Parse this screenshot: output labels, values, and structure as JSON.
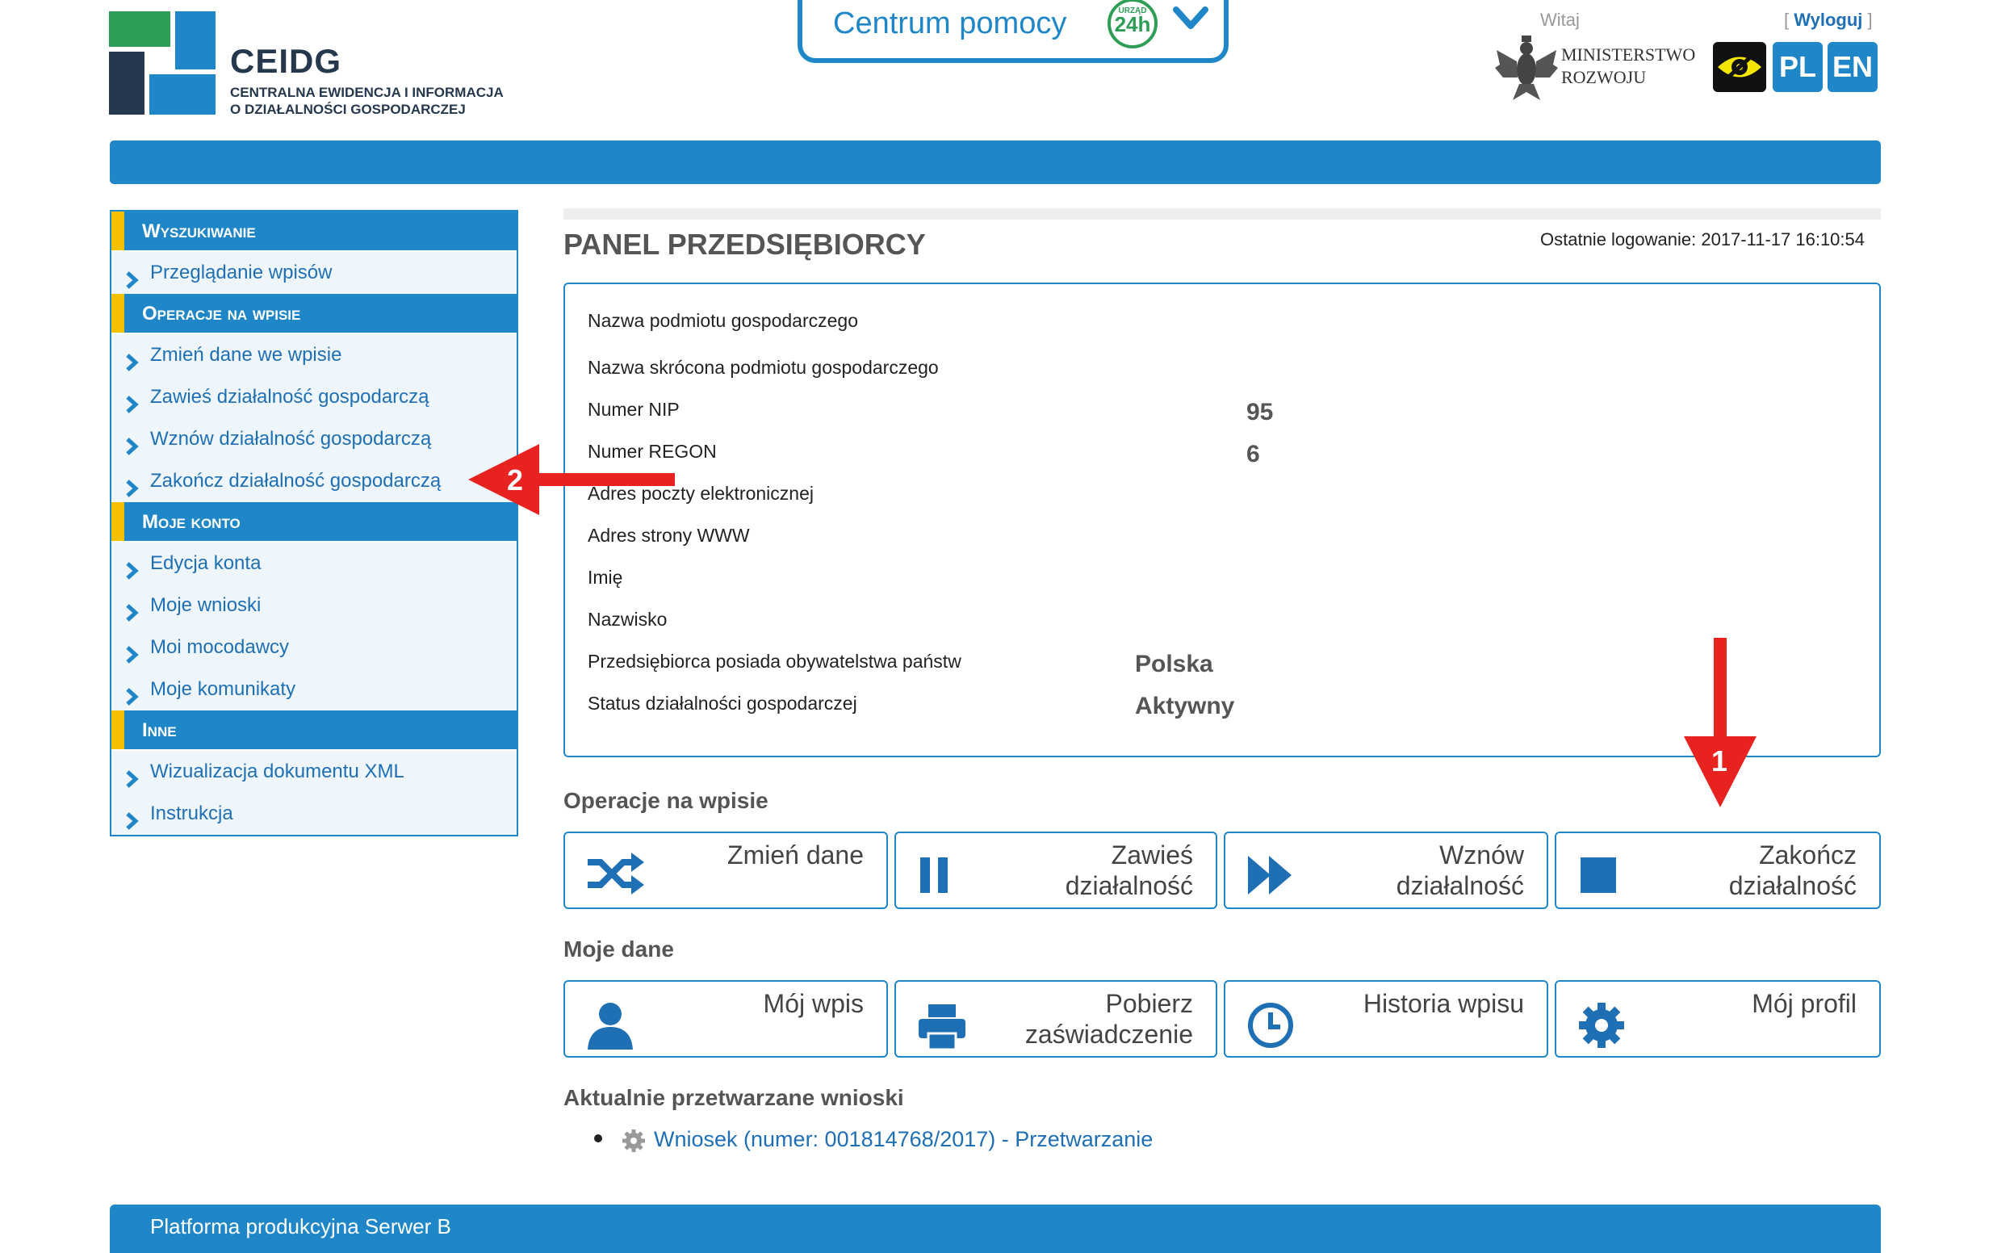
{
  "header": {
    "logo_title": "CEIDG",
    "logo_sub_1": "CENTRALNA EWIDENCJA I INFORMACJA",
    "logo_sub_2": "O DZIAŁALNOŚCI GOSPODARCZEJ",
    "help_label": "Centrum pomocy",
    "help_badge_top": "URZĄD",
    "help_badge_main": "24h",
    "welcome": "Witaj",
    "logout_open": "[",
    "logout": "Wyloguj",
    "logout_close": "]",
    "ministry_line1": "MINISTERSTWO",
    "ministry_line2": "ROZWOJU",
    "lang_pl": "PL",
    "lang_en": "EN"
  },
  "sidebar": {
    "sections": [
      {
        "title": "Wyszukiwanie",
        "items": [
          "Przeglądanie wpisów"
        ]
      },
      {
        "title": "Operacje na wpisie",
        "items": [
          "Zmień dane we wpisie",
          "Zawieś działalność gospodarczą",
          "Wznów działalność gospodarczą",
          "Zakończ działalność gospodarczą"
        ]
      },
      {
        "title": "Moje konto",
        "items": [
          "Edycja konta",
          "Moje wnioski",
          "Moi mocodawcy",
          "Moje komunikaty"
        ]
      },
      {
        "title": "Inne",
        "items": [
          "Wizualizacja dokumentu XML",
          "Instrukcja"
        ]
      }
    ]
  },
  "main": {
    "title": "PANEL PRZEDSIĘBIORCY",
    "last_login": "Ostatnie logowanie: 2017-11-17 16:10:54",
    "fields": [
      {
        "label": "Nazwa podmiotu gospodarczego",
        "value": ""
      },
      {
        "label": "Nazwa skrócona podmiotu gospodarczego",
        "value": ""
      },
      {
        "label": "Numer NIP",
        "value": "95"
      },
      {
        "label": "Numer REGON",
        "value": "6"
      },
      {
        "label": "Adres poczty elektronicznej",
        "value": ""
      },
      {
        "label": "Adres strony WWW",
        "value": ""
      },
      {
        "label": "Imię",
        "value": ""
      },
      {
        "label": "Nazwisko",
        "value": ""
      },
      {
        "label": "Przedsiębiorca posiada obywatelstwa państw",
        "value": "Polska"
      },
      {
        "label": "Status działalności gospodarczej",
        "value": "Aktywny"
      }
    ],
    "ops_title": "Operacje na wpisie",
    "ops": [
      {
        "line1": "Zmień dane",
        "line2": ""
      },
      {
        "line1": "Zawieś",
        "line2": "działalność"
      },
      {
        "line1": "Wznów",
        "line2": "działalność"
      },
      {
        "line1": "Zakończ",
        "line2": "działalność"
      }
    ],
    "mydata_title": "Moje dane",
    "mydata": [
      {
        "line1": "Mój wpis",
        "line2": ""
      },
      {
        "line1": "Pobierz",
        "line2": "zaświadczenie"
      },
      {
        "line1": "Historia wpisu",
        "line2": ""
      },
      {
        "line1": "Mój profil",
        "line2": ""
      }
    ],
    "requests_title": "Aktualnie przetwarzane wnioski",
    "request_link": "Wniosek (numer: 001814768/2017) - Przetwarzanie"
  },
  "annotations": {
    "arrow1": "1",
    "arrow2": "2"
  },
  "footer": {
    "text": "Platforma produkcyjna Serwer B"
  },
  "colors": {
    "primary": "#1f87c7",
    "accent": "#f5c000",
    "link": "#1f6fb5",
    "arrow": "#e8221e"
  }
}
